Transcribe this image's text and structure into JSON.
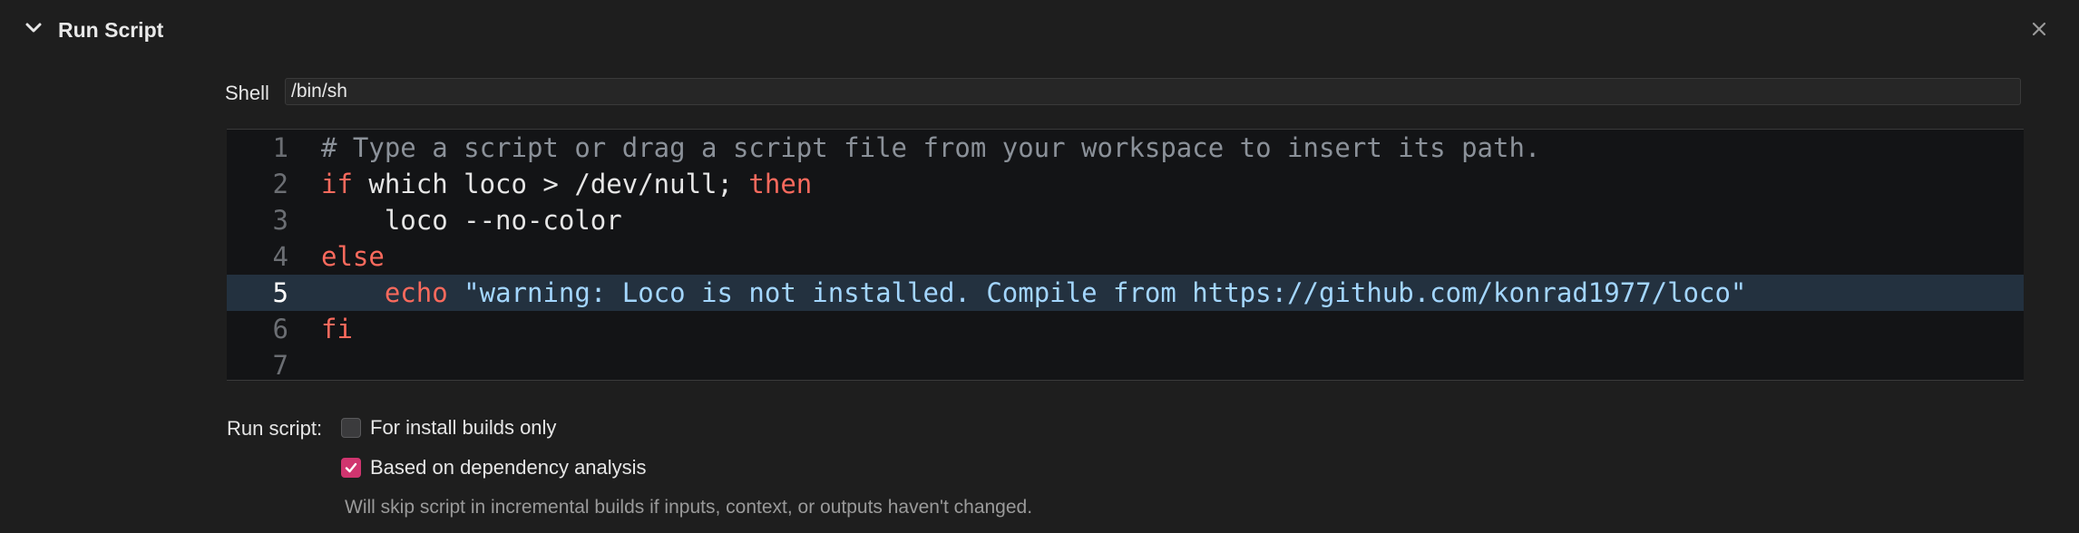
{
  "header": {
    "title": "Run Script",
    "expand_icon": "chevron-down-icon",
    "close_icon": "close-icon"
  },
  "shell": {
    "label": "Shell",
    "value": "/bin/sh"
  },
  "editor": {
    "current_line": 5,
    "lines": [
      {
        "number": "1",
        "tokens": [
          {
            "t": "cm",
            "v": "# Type a script or drag a script file from your workspace to insert its path."
          }
        ]
      },
      {
        "number": "2",
        "tokens": [
          {
            "t": "kw",
            "v": "if"
          },
          {
            "t": "pl",
            "v": " which loco > /dev/null; "
          },
          {
            "t": "kw",
            "v": "then"
          }
        ]
      },
      {
        "number": "3",
        "tokens": [
          {
            "t": "pl",
            "v": "    loco --no-color"
          }
        ]
      },
      {
        "number": "4",
        "tokens": [
          {
            "t": "kw",
            "v": "else"
          }
        ]
      },
      {
        "number": "5",
        "tokens": [
          {
            "t": "pl",
            "v": "    "
          },
          {
            "t": "kw",
            "v": "echo"
          },
          {
            "t": "pl",
            "v": " "
          },
          {
            "t": "str",
            "v": "\"warning: Loco is not installed. Compile from https://github.com/konrad1977/loco\""
          }
        ]
      },
      {
        "number": "6",
        "tokens": [
          {
            "t": "kw",
            "v": "fi"
          }
        ]
      },
      {
        "number": "7",
        "tokens": []
      }
    ]
  },
  "options": {
    "label": "Run script:",
    "install_only": {
      "label": "For install builds only",
      "checked": false
    },
    "dependency_analysis": {
      "label": "Based on dependency analysis",
      "checked": true
    },
    "note": "Will skip script in incremental builds if inputs, context, or outputs haven't changed."
  },
  "colors": {
    "background": "#1e1e1e",
    "editor_background": "#131416",
    "current_line": "#23313f",
    "keyword": "#fc6a5d",
    "comment": "#8b9199",
    "string": "#a3d6ff",
    "checkbox_accent": "#d0356f"
  }
}
